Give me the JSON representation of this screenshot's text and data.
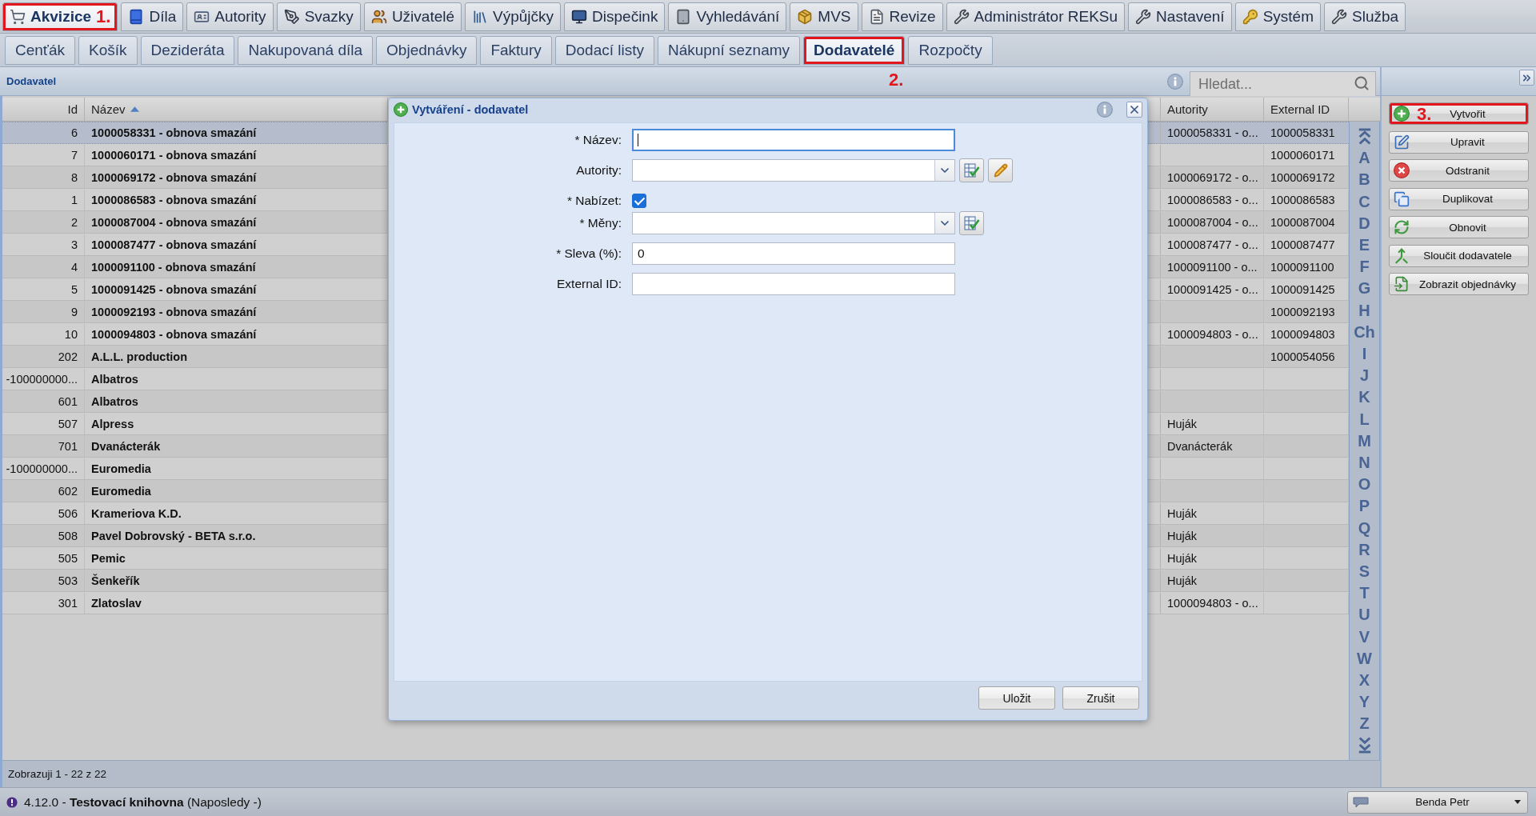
{
  "main_tabs": [
    {
      "label": "Akvizice",
      "kind": "acquisition",
      "selected": true,
      "callout": "1."
    },
    {
      "label": "Díla",
      "kind": "works",
      "selected": false
    },
    {
      "label": "Autority",
      "kind": "authorities",
      "selected": false
    },
    {
      "label": "Svazky",
      "kind": "volumes",
      "selected": false
    },
    {
      "label": "Uživatelé",
      "kind": "users",
      "selected": false
    },
    {
      "label": "Výpůjčky",
      "kind": "loans",
      "selected": false
    },
    {
      "label": "Dispečink",
      "kind": "dispatch",
      "selected": false
    },
    {
      "label": "Vyhledávání",
      "kind": "search",
      "selected": false
    },
    {
      "label": "MVS",
      "kind": "ill",
      "selected": false
    },
    {
      "label": "Revize",
      "kind": "revision",
      "selected": false
    },
    {
      "label": "Administrátor REKSu",
      "kind": "admin",
      "selected": false
    },
    {
      "label": "Nastavení",
      "kind": "settings",
      "selected": false
    },
    {
      "label": "Systém",
      "kind": "system",
      "selected": false
    },
    {
      "label": "Služba",
      "kind": "service",
      "selected": false
    }
  ],
  "sub_tabs": [
    {
      "label": "Cenťák",
      "selected": false
    },
    {
      "label": "Košík",
      "selected": false
    },
    {
      "label": "Dezideráta",
      "selected": false
    },
    {
      "label": "Nakupovaná díla",
      "selected": false
    },
    {
      "label": "Objednávky",
      "selected": false
    },
    {
      "label": "Faktury",
      "selected": false
    },
    {
      "label": "Dodací listy",
      "selected": false
    },
    {
      "label": "Nákupní seznamy",
      "selected": false
    },
    {
      "label": "Dodavatelé",
      "selected": true,
      "callout": "2."
    },
    {
      "label": "Rozpočty",
      "selected": false
    }
  ],
  "panel": {
    "title": "Dodavatel",
    "search": {
      "placeholder": "Hledat..."
    }
  },
  "table": {
    "columns": [
      {
        "label": "Id"
      },
      {
        "label": "Název",
        "sort_ascending": true
      },
      {
        "label": "Autority"
      },
      {
        "label": "External ID"
      }
    ],
    "rows": [
      {
        "id": "6",
        "name": "1000058331 - obnova smazání",
        "autority": "1000058331 - o...",
        "external_id": "1000058331",
        "selected": true
      },
      {
        "id": "7",
        "name": "1000060171 - obnova smazání",
        "external_id": "1000060171",
        "selected": false
      },
      {
        "id": "8",
        "name": "1000069172 - obnova smazání",
        "autority": "1000069172 - o...",
        "external_id": "1000069172",
        "selected": false
      },
      {
        "id": "1",
        "name": "1000086583 - obnova smazání",
        "autority": "1000086583 - o...",
        "external_id": "1000086583",
        "selected": false
      },
      {
        "id": "2",
        "name": "1000087004 - obnova smazání",
        "autority": "1000087004 - o...",
        "external_id": "1000087004",
        "selected": false
      },
      {
        "id": "3",
        "name": "1000087477 - obnova smazání",
        "autority": "1000087477 - o...",
        "external_id": "1000087477",
        "selected": false
      },
      {
        "id": "4",
        "name": "1000091100 - obnova smazání",
        "autority": "1000091100 - o...",
        "external_id": "1000091100",
        "selected": false
      },
      {
        "id": "5",
        "name": "1000091425 - obnova smazání",
        "autority": "1000091425 - o...",
        "external_id": "1000091425",
        "selected": false
      },
      {
        "id": "9",
        "name": "1000092193 - obnova smazání",
        "external_id": "1000092193",
        "selected": false
      },
      {
        "id": "10",
        "name": "1000094803 - obnova smazání",
        "autority": "1000094803 - o...",
        "external_id": "1000094803",
        "selected": false
      },
      {
        "id": "202",
        "name": "A.L.L. production",
        "external_id": "1000054056",
        "selected": false
      },
      {
        "id": "-100000000...",
        "name": "Albatros",
        "selected": false
      },
      {
        "id": "601",
        "name": "Albatros",
        "selected": false
      },
      {
        "id": "507",
        "name": "Alpress",
        "autority": "Huják",
        "selected": false
      },
      {
        "id": "701",
        "name": "Dvanácterák",
        "autority": "Dvanácterák",
        "selected": false
      },
      {
        "id": "-100000000...",
        "name": "Euromedia",
        "selected": false
      },
      {
        "id": "602",
        "name": "Euromedia",
        "selected": false
      },
      {
        "id": "506",
        "name": "Krameriova K.D.",
        "autority": "Huják",
        "selected": false
      },
      {
        "id": "508",
        "name": "Pavel Dobrovský - BETA s.r.o.",
        "autority": "Huják",
        "selected": false
      },
      {
        "id": "505",
        "name": "Pemic",
        "autority": "Huják",
        "selected": false
      },
      {
        "id": "503",
        "name": "Šenkeřík",
        "autority": "Huják",
        "selected": false
      },
      {
        "id": "301",
        "name": "Zlatoslav",
        "autority": "1000094803 - o...",
        "selected": false
      }
    ],
    "footer": "Zobrazuji 1 - 22 z 22"
  },
  "alphabet": [
    "A",
    "B",
    "C",
    "D",
    "E",
    "F",
    "G",
    "H",
    "Ch",
    "I",
    "J",
    "K",
    "L",
    "M",
    "N",
    "O",
    "P",
    "Q",
    "R",
    "S",
    "T",
    "U",
    "V",
    "W",
    "X",
    "Y",
    "Z"
  ],
  "actions": [
    {
      "label": "Vytvořit",
      "kind": "create",
      "callout": "3."
    },
    {
      "label": "Upravit",
      "kind": "edit"
    },
    {
      "label": "Odstranit",
      "kind": "delete"
    },
    {
      "label": "Duplikovat",
      "kind": "duplicate"
    },
    {
      "label": "Obnovit",
      "kind": "refresh"
    },
    {
      "label": "Sloučit dodavatele",
      "kind": "merge"
    },
    {
      "label": "Zobrazit objednávky",
      "kind": "orders"
    }
  ],
  "dialog": {
    "title": "Vytváření - dodavatel",
    "fields": [
      {
        "label": "* Název:",
        "kind": "text",
        "focused": true
      },
      {
        "label": "Autority:",
        "kind": "lookup"
      },
      {
        "label": "* Nabízet:",
        "kind": "checkbox",
        "checked": true
      },
      {
        "label": "* Měny:",
        "kind": "picker"
      },
      {
        "label": "* Sleva (%):",
        "kind": "text",
        "value": "0",
        "focused": false
      },
      {
        "label": "External ID:",
        "kind": "text",
        "focused": false
      }
    ],
    "buttons": [
      "Uložit",
      "Zrušit"
    ]
  },
  "status_bar": {
    "text": "4.12.0 - **Testovací knihovna** (Naposledy -)",
    "user": "Benda Petr"
  }
}
